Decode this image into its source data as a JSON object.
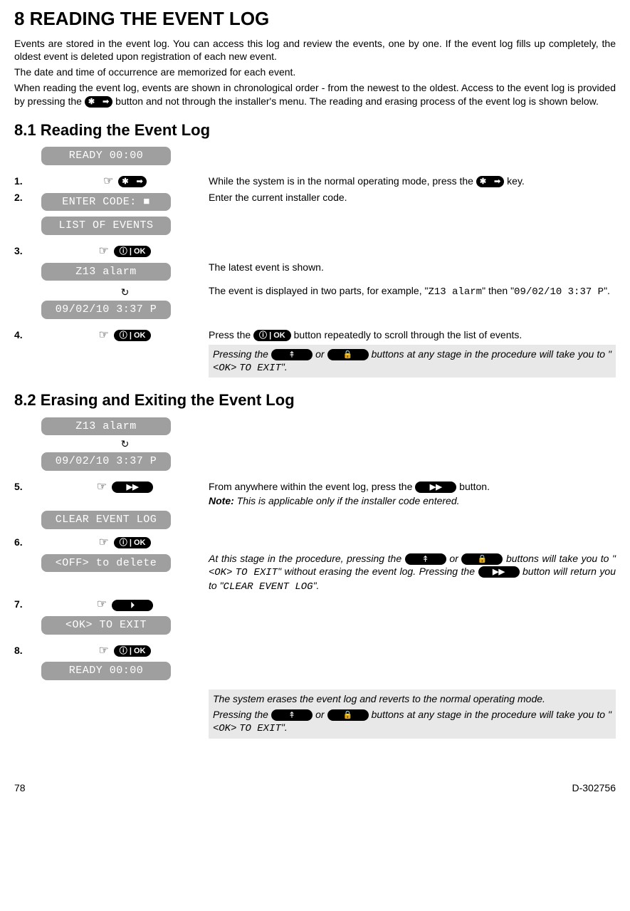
{
  "head": {
    "title": "8 READING THE EVENT LOG",
    "p1": "Events are stored in the event log. You can access this log and review the events, one by one. If the event log fills up completely, the oldest event is deleted upon registration of each new event.",
    "p2": "The date and time of occurrence are memorized for each event.",
    "p3a": "When reading the event log, events are shown in chronological order - from the newest to the oldest. Access to the event log is provided by pressing the ",
    "p3b": " button and not through the installer's menu. The reading and erasing process of the event log is shown below."
  },
  "s81": {
    "title": "8.1 Reading the Event Log",
    "lcd_ready": "READY 00:00",
    "step1_num": "1.",
    "step1_text_a": "While the system is in the normal operating mode, press the ",
    "step1_text_b": " key.",
    "step2_num": "2.",
    "lcd_enter_code": "ENTER CODE: ■",
    "step2_text": "Enter the current installer code.",
    "lcd_list": "LIST OF EVENTS",
    "step3_num": "3.",
    "lcd_z13": "Z13 alarm",
    "step3_text": "The latest event is shown.",
    "step3b_text_a": "The event is displayed in two parts, for example, \"",
    "step3b_code1": "Z13 alarm",
    "step3b_text_mid": "\" then \"",
    "step3b_code2": "09/02/10 3:37 P",
    "step3b_text_b": "\".",
    "lcd_date": "09/02/10 3:37 P",
    "step4_num": "4.",
    "step4_text_a": "Press the ",
    "step4_text_b": " button repeatedly to scroll through the list of events.",
    "note_a": "Pressing the ",
    "note_mid": " or ",
    "note_b": " buttons at any stage in the procedure will take you to \"<",
    "note_ok": "OK",
    "note_c": "> ",
    "note_exit": "TO EXIT",
    "note_end": "\"."
  },
  "s82": {
    "title": "8.2 Erasing and Exiting the Event Log",
    "lcd_z13": "Z13 alarm",
    "lcd_date": "09/02/10 3:37 P",
    "step5_num": "5.",
    "step5_text_a": "From anywhere within the event log, press the ",
    "step5_text_b": " button.",
    "step5_note_bold": "Note:",
    "step5_note_rest": " This is applicable only if the installer code entered.",
    "lcd_clear": "CLEAR EVENT LOG",
    "step6_num": "6.",
    "lcd_off": "<OFF> to delete",
    "step6_text_a": "At this stage in the procedure, pressing the ",
    "step6_text_mid": " or ",
    "step6_text_b": " buttons will take you to \"<",
    "step6_ok": "OK",
    "step6_text_c": "> ",
    "step6_exit": "TO EXIT",
    "step6_text_d": "\" without erasing the event log. Pressing the ",
    "step6_text_e": " button will return you to \"",
    "step6_clear": "CLEAR EVENT LOG",
    "step6_text_f": "\".",
    "step7_num": "7.",
    "lcd_ok_exit": "<OK> TO EXIT",
    "step8_num": "8.",
    "lcd_ready": "READY 00:00",
    "finalnote1": "The system erases the event log and reverts to the normal operating mode.",
    "finalnote2_a": "Pressing the ",
    "finalnote2_mid": " or ",
    "finalnote2_b": " buttons at any stage in the procedure will take you to \"<",
    "finalnote2_ok": "OK",
    "finalnote2_c": "> ",
    "finalnote2_exit": "TO EXIT",
    "finalnote2_end": "\"."
  },
  "key": {
    "star": "✱",
    "tool": "➟",
    "ok": "ⓘ | OK",
    "up": "⤉",
    "lock": "🔒",
    "unlock": "⏵",
    "ff": "▶▶"
  },
  "footer": {
    "page": "78",
    "doc": "D-302756"
  }
}
